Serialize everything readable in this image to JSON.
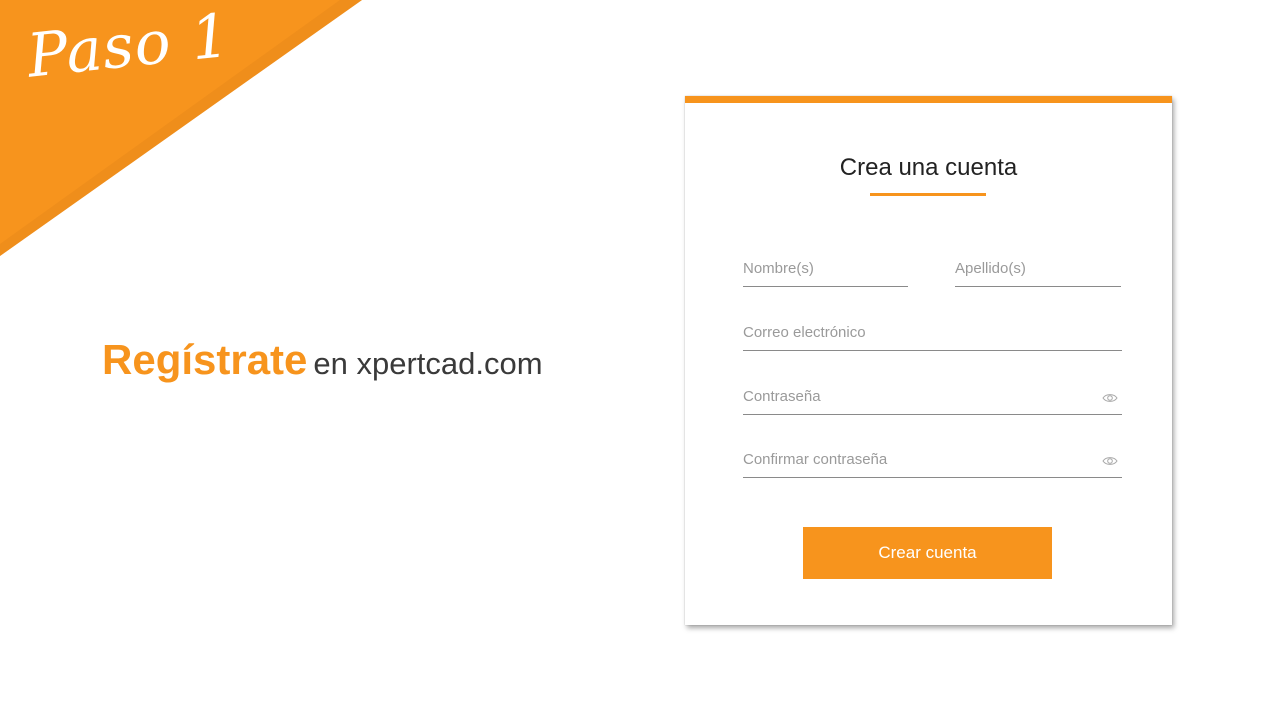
{
  "banner": {
    "step_label": "Paso 1",
    "color": "#f7941d"
  },
  "headline": {
    "accent_text": "Regístrate",
    "rest_text": "en xpertcad.com",
    "accent_color": "#f7941d"
  },
  "form": {
    "title": "Crea una cuenta",
    "accent_color": "#f7941d",
    "fields": {
      "first_name": {
        "placeholder": "Nombre(s)",
        "value": ""
      },
      "last_name": {
        "placeholder": "Apellido(s)",
        "value": ""
      },
      "email": {
        "placeholder": "Correo electrónico",
        "value": ""
      },
      "password": {
        "placeholder": "Contraseña",
        "value": "",
        "icon": "eye-icon"
      },
      "confirm_password": {
        "placeholder": "Confirmar contraseña",
        "value": "",
        "icon": "eye-icon"
      }
    },
    "submit_label": "Crear cuenta"
  }
}
